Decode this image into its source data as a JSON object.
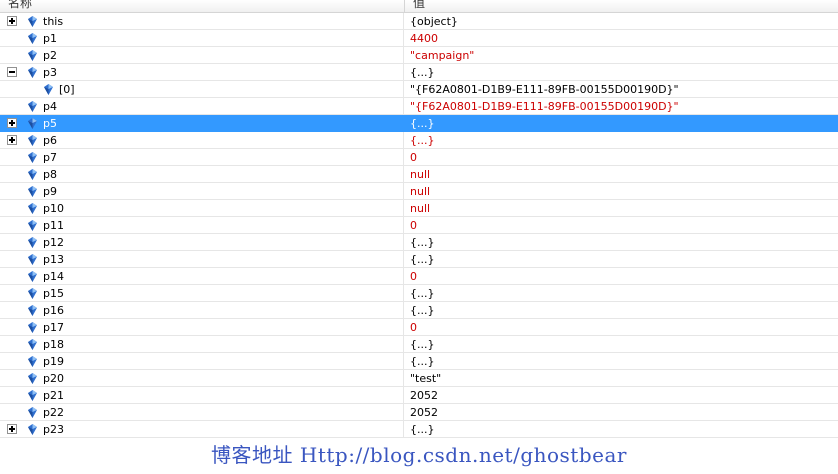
{
  "header": {
    "name": "名称",
    "value": "值"
  },
  "colors": {
    "changed": "#cc0000",
    "normal": "#000000",
    "selection": "#3399ff",
    "watermark": "#3a56c0"
  },
  "rows": [
    {
      "name": "this",
      "value": "{object}",
      "changed": false,
      "expander": "plus",
      "indent": 0
    },
    {
      "name": "p1",
      "value": "4400",
      "changed": true,
      "expander": "",
      "indent": 0
    },
    {
      "name": "p2",
      "value": "\"campaign\"",
      "changed": true,
      "expander": "",
      "indent": 0
    },
    {
      "name": "p3",
      "value": "{...}",
      "changed": false,
      "expander": "minus",
      "indent": 0
    },
    {
      "name": "[0]",
      "value": "\"{F62A0801-D1B9-E111-89FB-00155D00190D}\"",
      "changed": false,
      "expander": "",
      "indent": 1
    },
    {
      "name": "p4",
      "value": "\"{F62A0801-D1B9-E111-89FB-00155D00190D}\"",
      "changed": true,
      "expander": "",
      "indent": 0
    },
    {
      "name": "p5",
      "value": "{...}",
      "changed": false,
      "expander": "plus",
      "indent": 0,
      "selected": true
    },
    {
      "name": "p6",
      "value": "{...}",
      "changed": true,
      "expander": "plus",
      "indent": 0
    },
    {
      "name": "p7",
      "value": "0",
      "changed": true,
      "expander": "",
      "indent": 0
    },
    {
      "name": "p8",
      "value": "null",
      "changed": true,
      "expander": "",
      "indent": 0
    },
    {
      "name": "p9",
      "value": "null",
      "changed": true,
      "expander": "",
      "indent": 0
    },
    {
      "name": "p10",
      "value": "null",
      "changed": true,
      "expander": "",
      "indent": 0
    },
    {
      "name": "p11",
      "value": "0",
      "changed": true,
      "expander": "",
      "indent": 0
    },
    {
      "name": "p12",
      "value": "{...}",
      "changed": false,
      "expander": "",
      "indent": 0
    },
    {
      "name": "p13",
      "value": "{...}",
      "changed": false,
      "expander": "",
      "indent": 0
    },
    {
      "name": "p14",
      "value": "0",
      "changed": true,
      "expander": "",
      "indent": 0
    },
    {
      "name": "p15",
      "value": "{...}",
      "changed": false,
      "expander": "",
      "indent": 0
    },
    {
      "name": "p16",
      "value": "{...}",
      "changed": false,
      "expander": "",
      "indent": 0
    },
    {
      "name": "p17",
      "value": "0",
      "changed": true,
      "expander": "",
      "indent": 0
    },
    {
      "name": "p18",
      "value": "{...}",
      "changed": false,
      "expander": "",
      "indent": 0
    },
    {
      "name": "p19",
      "value": "{...}",
      "changed": false,
      "expander": "",
      "indent": 0
    },
    {
      "name": "p20",
      "value": "\"test\"",
      "changed": false,
      "expander": "",
      "indent": 0
    },
    {
      "name": "p21",
      "value": "2052",
      "changed": false,
      "expander": "",
      "indent": 0
    },
    {
      "name": "p22",
      "value": "2052",
      "changed": false,
      "expander": "",
      "indent": 0
    },
    {
      "name": "p23",
      "value": "{...}",
      "changed": false,
      "expander": "plus",
      "indent": 0
    }
  ],
  "watermark": "博客地址 Http://blog.csdn.net/ghostbear"
}
